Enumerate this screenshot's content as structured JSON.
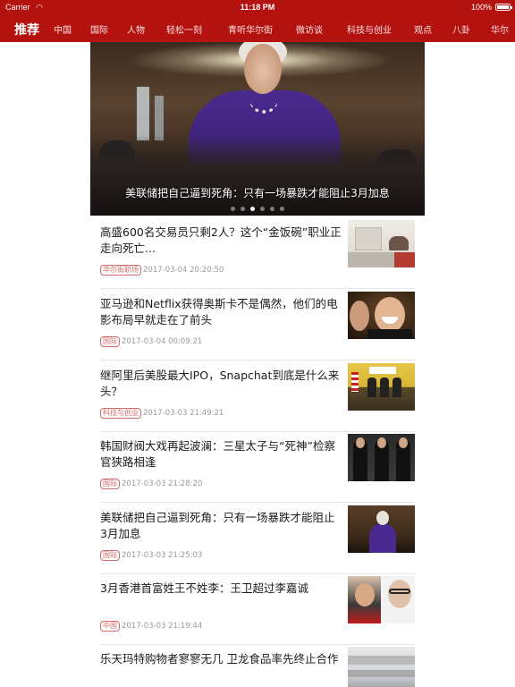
{
  "status_bar": {
    "carrier": "Carrier",
    "wifi_icon": "wifi-icon",
    "time": "11:18 PM",
    "battery": "100%",
    "battery_icon": "battery-icon"
  },
  "nav": {
    "items": [
      "推荐",
      "中国",
      "国际",
      "人物",
      "轻松一刻",
      "青听华尔街",
      "微访谈",
      "科技与创业",
      "观点",
      "八卦",
      "华尔"
    ],
    "active_index": 0,
    "bar_color": "#b3120f"
  },
  "hero": {
    "caption": "美联储把自己逼到死角：只有一场暴跌才能阻止3月加息",
    "page_count": 6,
    "active_page": 3
  },
  "articles": [
    {
      "title": "高盛600名交易员只剩2人？这个“金饭碗”职业正走向死亡...",
      "tag": "华尔街职场",
      "time": "2017-03-04 20:20:50"
    },
    {
      "title": "亚马逊和Netflix获得奥斯卡不是偶然，他们的电影布局早就走在了前头",
      "tag": "国际",
      "time": "2017-03-04 00:09:21"
    },
    {
      "title": "继阿里后美股最大IPO，Snapchat到底是什么来头？",
      "tag": "科技与创业",
      "time": "2017-03-03 21:49:21"
    },
    {
      "title": "韩国财阀大戏再起波澜：三星太子与“死神”检察官狭路相逢",
      "tag": "国际",
      "time": "2017-03-03 21:28:20"
    },
    {
      "title": "美联储把自己逼到死角：只有一场暴跌才能阻止3月加息",
      "tag": "国际",
      "time": "2017-03-03 21:25:03"
    },
    {
      "title": "3月香港首富姓王不姓李：王卫超过李嘉诚",
      "tag": "中国",
      "time": "2017-03-03 21:19:44"
    },
    {
      "title": "乐天玛特购物者寥寥无几 卫龙食品率先终止合作",
      "tag": "",
      "time": ""
    }
  ]
}
